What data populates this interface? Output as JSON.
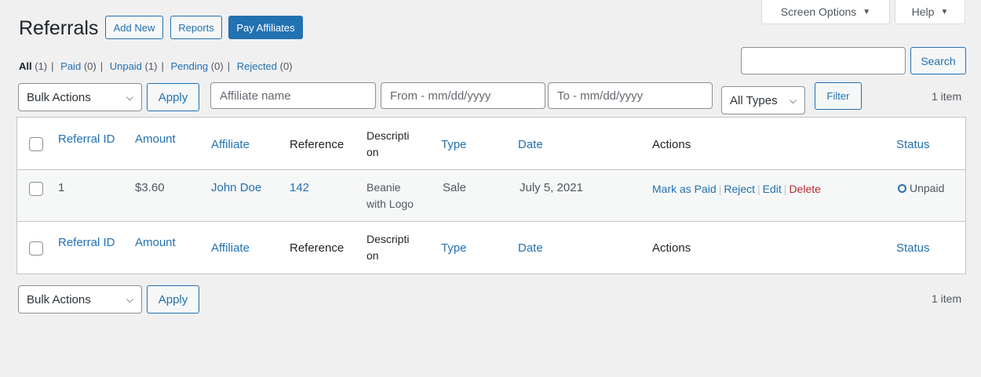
{
  "top_tabs": {
    "screen_options": "Screen Options",
    "help": "Help",
    "arrow": "▼"
  },
  "page": {
    "title": "Referrals",
    "buttons": {
      "add_new": "Add New",
      "reports": "Reports",
      "pay_affiliates": "Pay Affiliates"
    }
  },
  "filters_nav": [
    {
      "label": "All",
      "count": "(1)"
    },
    {
      "label": "Paid",
      "count": "(0)"
    },
    {
      "label": "Unpaid",
      "count": "(1)"
    },
    {
      "label": "Pending",
      "count": "(0)"
    },
    {
      "label": "Rejected",
      "count": "(0)"
    }
  ],
  "search": {
    "value": "",
    "button": "Search"
  },
  "tablenav_top": {
    "bulk_actions": "Bulk Actions",
    "apply": "Apply",
    "affiliate_placeholder": "Affiliate name",
    "from_placeholder": "From - mm/dd/yyyy",
    "to_placeholder": "To - mm/dd/yyyy",
    "types": "All Types",
    "filter": "Filter",
    "item_count": "1 item"
  },
  "table": {
    "columns": {
      "referral_id": "Referral ID",
      "amount": "Amount",
      "affiliate": "Affiliate",
      "reference": "Reference",
      "description_1": "Descripti",
      "description_2": "on",
      "type": "Type",
      "date": "Date",
      "actions": "Actions",
      "status": "Status"
    },
    "rows": [
      {
        "referral_id": "1",
        "amount": "$3.60",
        "affiliate": "John Doe",
        "reference": "142",
        "description_1": "Beanie",
        "description_2": "with Logo",
        "type": "Sale",
        "date": "July 5, 2021",
        "actions": {
          "mark_paid": "Mark as Paid",
          "reject": "Reject",
          "edit": "Edit",
          "delete": "Delete"
        },
        "status": "Unpaid"
      }
    ]
  },
  "tablenav_bottom": {
    "bulk_actions": "Bulk Actions",
    "apply": "Apply",
    "item_count": "1 item"
  }
}
